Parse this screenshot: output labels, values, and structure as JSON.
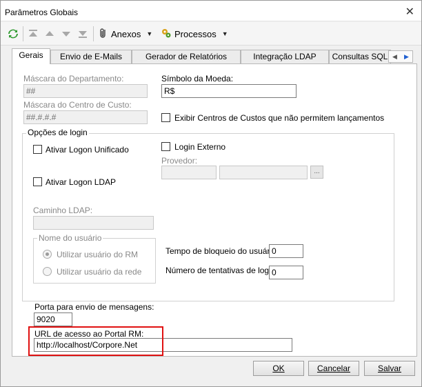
{
  "window": {
    "title": "Parâmetros Globais"
  },
  "toolbar": {
    "anexos_label": "Anexos",
    "processos_label": "Processos",
    "icons": [
      "refresh-icon",
      "first-icon",
      "prev-icon",
      "next-icon",
      "last-icon",
      "paperclip-icon",
      "gears-icon"
    ]
  },
  "tabs": [
    "Gerais",
    "Envio de E-Mails",
    "Gerador de Relatórios",
    "Integração LDAP",
    "Consultas SQL"
  ],
  "gerais": {
    "mascara_departamento": {
      "label": "Máscara do Departamento:",
      "value": "##"
    },
    "mascara_centro_custo": {
      "label": "Máscara do Centro de Custo:",
      "value": "##.#.#.#"
    },
    "simbolo_moeda": {
      "label": "Símbolo da Moeda:",
      "value": "R$"
    },
    "exibir_centros_custos": "Exibir Centros de Custos que não permitem lançamentos",
    "opcoes_login": {
      "title": "Opções de login",
      "ativar_logon_unificado": "Ativar Logon Unificado",
      "login_externo": "Login Externo",
      "provedor_label": "Provedor:",
      "ativar_logon_ldap": "Ativar Logon LDAP",
      "caminho_ldap_label": "Caminho LDAP:",
      "nome_usuario": {
        "title": "Nome do usuário",
        "opt_rm": "Utilizar usuário do RM",
        "opt_rede": "Utilizar usuário da rede"
      },
      "tempo_bloqueio": {
        "label": "Tempo de bloqueio do usuário:",
        "value": "0"
      },
      "numero_tentativas": {
        "label": "Número de tentativas de login:",
        "value": "0"
      }
    },
    "porta_mensagens": {
      "label": "Porta para envio de mensagens:",
      "value": "9020"
    },
    "url_portal": {
      "label": "URL de acesso ao Portal RM:",
      "value": "http://localhost/Corpore.Net"
    }
  },
  "footer": {
    "ok": "OK",
    "cancelar": "Cancelar",
    "salvar": "Salvar"
  },
  "colors": {
    "highlight": "#e01010"
  }
}
